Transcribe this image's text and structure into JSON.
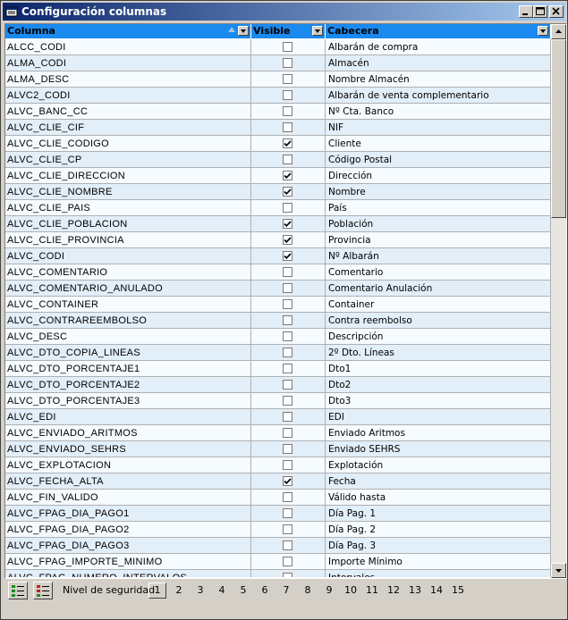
{
  "window": {
    "title": "Configuración columnas"
  },
  "grid": {
    "headers": {
      "columna": "Columna",
      "visible": "Visible",
      "cabecera": "Cabecera"
    },
    "rows": [
      {
        "columna": "ALCC_CODI",
        "visible": false,
        "cabecera": "Albarán de compra"
      },
      {
        "columna": "ALMA_CODI",
        "visible": false,
        "cabecera": "Almacén"
      },
      {
        "columna": "ALMA_DESC",
        "visible": false,
        "cabecera": "Nombre Almacén"
      },
      {
        "columna": "ALVC2_CODI",
        "visible": false,
        "cabecera": "Albarán de venta complementario"
      },
      {
        "columna": "ALVC_BANC_CC",
        "visible": false,
        "cabecera": "Nº Cta. Banco"
      },
      {
        "columna": "ALVC_CLIE_CIF",
        "visible": false,
        "cabecera": "NIF"
      },
      {
        "columna": "ALVC_CLIE_CODIGO",
        "visible": true,
        "cabecera": "Cliente"
      },
      {
        "columna": "ALVC_CLIE_CP",
        "visible": false,
        "cabecera": "Código Postal"
      },
      {
        "columna": "ALVC_CLIE_DIRECCION",
        "visible": true,
        "cabecera": "Dirección"
      },
      {
        "columna": "ALVC_CLIE_NOMBRE",
        "visible": true,
        "cabecera": "Nombre"
      },
      {
        "columna": "ALVC_CLIE_PAIS",
        "visible": false,
        "cabecera": "País"
      },
      {
        "columna": "ALVC_CLIE_POBLACION",
        "visible": true,
        "cabecera": "Población"
      },
      {
        "columna": "ALVC_CLIE_PROVINCIA",
        "visible": true,
        "cabecera": "Provincia"
      },
      {
        "columna": "ALVC_CODI",
        "visible": true,
        "cabecera": "Nº Albarán"
      },
      {
        "columna": "ALVC_COMENTARIO",
        "visible": false,
        "cabecera": "Comentario"
      },
      {
        "columna": "ALVC_COMENTARIO_ANULADO",
        "visible": false,
        "cabecera": "Comentario Anulación"
      },
      {
        "columna": "ALVC_CONTAINER",
        "visible": false,
        "cabecera": "Container"
      },
      {
        "columna": "ALVC_CONTRAREEMBOLSO",
        "visible": false,
        "cabecera": "Contra reembolso"
      },
      {
        "columna": "ALVC_DESC",
        "visible": false,
        "cabecera": "Descripción"
      },
      {
        "columna": "ALVC_DTO_COPIA_LINEAS",
        "visible": false,
        "cabecera": "2º Dto. Líneas"
      },
      {
        "columna": "ALVC_DTO_PORCENTAJE1",
        "visible": false,
        "cabecera": "Dto1"
      },
      {
        "columna": "ALVC_DTO_PORCENTAJE2",
        "visible": false,
        "cabecera": "Dto2"
      },
      {
        "columna": "ALVC_DTO_PORCENTAJE3",
        "visible": false,
        "cabecera": "Dto3"
      },
      {
        "columna": "ALVC_EDI",
        "visible": false,
        "cabecera": "EDI"
      },
      {
        "columna": "ALVC_ENVIADO_ARITMOS",
        "visible": false,
        "cabecera": "Enviado Aritmos"
      },
      {
        "columna": "ALVC_ENVIADO_SEHRS",
        "visible": false,
        "cabecera": "Enviado SEHRS"
      },
      {
        "columna": "ALVC_EXPLOTACION",
        "visible": false,
        "cabecera": "Explotación"
      },
      {
        "columna": "ALVC_FECHA_ALTA",
        "visible": true,
        "cabecera": "Fecha"
      },
      {
        "columna": "ALVC_FIN_VALIDO",
        "visible": false,
        "cabecera": "Válido hasta"
      },
      {
        "columna": "ALVC_FPAG_DIA_PAGO1",
        "visible": false,
        "cabecera": "Día Pag. 1"
      },
      {
        "columna": "ALVC_FPAG_DIA_PAGO2",
        "visible": false,
        "cabecera": "Día Pag. 2"
      },
      {
        "columna": "ALVC_FPAG_DIA_PAGO3",
        "visible": false,
        "cabecera": "Día Pag. 3"
      },
      {
        "columna": "ALVC_FPAG_IMPORTE_MINIMO",
        "visible": false,
        "cabecera": "Importe Mínimo"
      },
      {
        "columna": "ALVC_FPAG_NUMERO_INTERVALOS",
        "visible": false,
        "cabecera": "Intervalos"
      }
    ]
  },
  "footer": {
    "label": "Nivel de seguridad",
    "levels": [
      "1",
      "2",
      "3",
      "4",
      "5",
      "6",
      "7",
      "8",
      "9",
      "10",
      "11",
      "12",
      "13",
      "14",
      "15"
    ],
    "selected_level": "1"
  },
  "colors": {
    "header_bg": "#1a8aee",
    "title_start": "#0a246a",
    "title_end": "#a6caf0",
    "row_alt": "#e2eef8"
  }
}
